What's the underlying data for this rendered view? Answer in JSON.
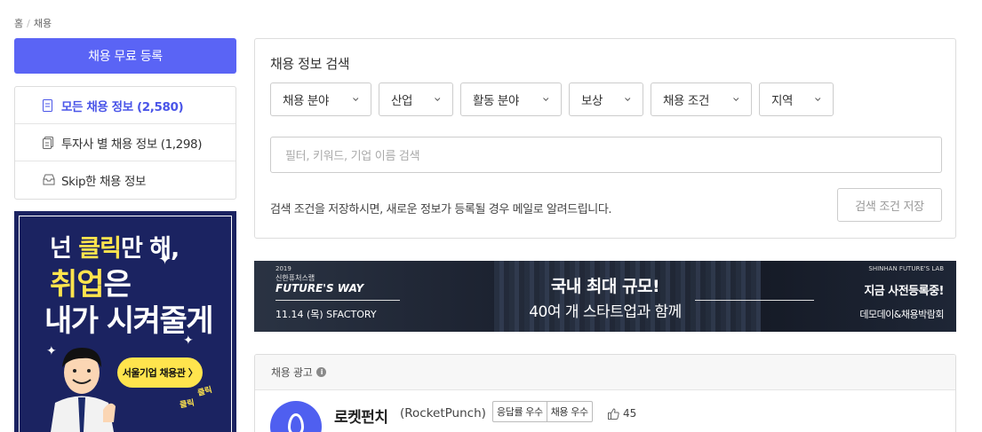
{
  "breadcrumb": {
    "home": "홈",
    "current": "채용"
  },
  "sidebar": {
    "register_label": "채용 무료 등록",
    "items": [
      {
        "label": "모든 채용 정보 (2,580)",
        "active": true,
        "icon": "document-icon"
      },
      {
        "label": "투자사 별 채용 정보 (1,298)",
        "active": false,
        "icon": "documents-icon"
      },
      {
        "label": "Skip한 채용 정보",
        "active": false,
        "icon": "inbox-icon"
      }
    ],
    "ad": {
      "line1_a": "넌 ",
      "line1_b": "클릭",
      "line1_c": "만 해,",
      "line2_a": "취업",
      "line2_b": "은",
      "line3": "내가 시켜줄게",
      "bubble": "서울기업 채용관 〉",
      "click1": "클릭",
      "click2": "클릭"
    }
  },
  "search_panel": {
    "title": "채용 정보 검색",
    "filters": [
      "채용 분야",
      "산업",
      "활동 분야",
      "보상",
      "채용 조건",
      "지역"
    ],
    "search_placeholder": "필터, 키워드, 기업 이름 검색",
    "notice": "검색 조건을 저장하시면, 새로운 정보가 등록될 경우 메일로 알려드립니다.",
    "save_label": "검색 조건 저장"
  },
  "banner": {
    "year": "2019",
    "subtitle": "신한퓨처스랩",
    "event": "FUTURE'S WAY",
    "date": "11.14 (목) SFACTORY",
    "headline1": "국내 최대 규모!",
    "headline2": "40여 개 스타트업과 함께",
    "lab": "SHINHAN FUTURE'S LAB",
    "right1": "지금 사전등록중!",
    "right2": "데모데이&채용박람회"
  },
  "job_ads": {
    "header": "채용 광고",
    "company": {
      "name": "로켓펀치",
      "english_name": "(RocketPunch)",
      "badges": [
        "응답률 우수",
        "채용 우수"
      ],
      "likes": "45"
    }
  },
  "colors": {
    "accent": "#5a64f5",
    "ad_bg": "#1b2361",
    "ad_yellow": "#ffe44d"
  }
}
